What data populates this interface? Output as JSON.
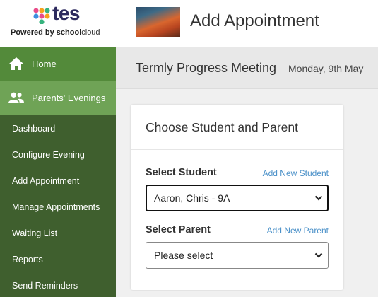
{
  "brand": {
    "logo_text": "tes",
    "powered_prefix": "Powered by ",
    "powered_school": "school",
    "powered_cloud": "cloud",
    "logo_colors": [
      "#e94b8a",
      "#f6a21e",
      "#36b37e",
      "#3d8ede"
    ]
  },
  "header": {
    "title": "Add Appointment"
  },
  "sidebar": {
    "primary": [
      {
        "label": "Home",
        "icon": "home-icon"
      },
      {
        "label": "Parents' Evenings",
        "icon": "people-icon"
      }
    ],
    "items": [
      {
        "label": "Dashboard"
      },
      {
        "label": "Configure Evening"
      },
      {
        "label": "Add Appointment"
      },
      {
        "label": "Manage Appointments"
      },
      {
        "label": "Waiting List"
      },
      {
        "label": "Reports"
      },
      {
        "label": "Send Reminders"
      }
    ]
  },
  "subheader": {
    "meeting": "Termly Progress Meeting",
    "date": "Monday, 9th May"
  },
  "card": {
    "title": "Choose Student and Parent",
    "student": {
      "label": "Select Student",
      "link": "Add New Student",
      "value": "Aaron, Chris - 9A"
    },
    "parent": {
      "label": "Select Parent",
      "link": "Add New Parent",
      "value": "Please select"
    }
  },
  "colors": {
    "sidebar_dark": "#3f5f2e",
    "sidebar_home": "#538a3a",
    "sidebar_active": "#6fa356",
    "link": "#4a90c8"
  }
}
